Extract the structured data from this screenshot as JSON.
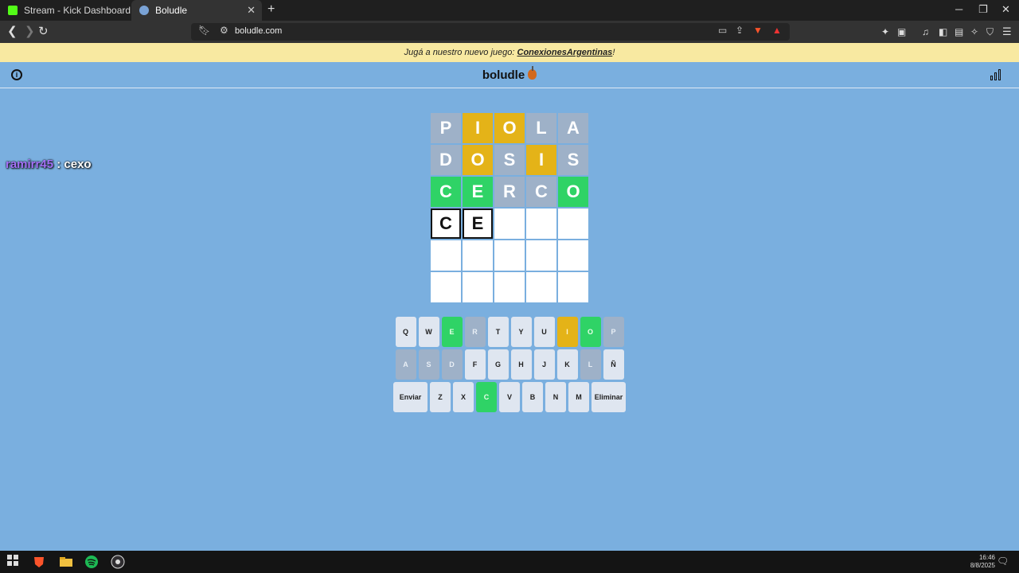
{
  "browser": {
    "tabs": [
      {
        "title": "Stream - Kick Dashboard",
        "active": false
      },
      {
        "title": "Boludle",
        "active": true
      }
    ],
    "new_tab": "+",
    "url": "boludle.com"
  },
  "announcement": {
    "prefix": "Jugá a nuestro nuevo juego: ",
    "link": "ConexionesArgentinas",
    "suffix": "!"
  },
  "header": {
    "title": "boludle"
  },
  "chat": {
    "user": "ramirr45",
    "separator": " : ",
    "message": "cexo"
  },
  "board": [
    [
      {
        "l": "P",
        "s": "gray"
      },
      {
        "l": "I",
        "s": "yellow"
      },
      {
        "l": "O",
        "s": "yellow"
      },
      {
        "l": "L",
        "s": "gray"
      },
      {
        "l": "A",
        "s": "gray"
      }
    ],
    [
      {
        "l": "D",
        "s": "gray"
      },
      {
        "l": "O",
        "s": "yellow"
      },
      {
        "l": "S",
        "s": "gray"
      },
      {
        "l": "I",
        "s": "yellow"
      },
      {
        "l": "S",
        "s": "gray"
      }
    ],
    [
      {
        "l": "C",
        "s": "green"
      },
      {
        "l": "E",
        "s": "green"
      },
      {
        "l": "R",
        "s": "gray"
      },
      {
        "l": "C",
        "s": "gray"
      },
      {
        "l": "O",
        "s": "green"
      }
    ],
    [
      {
        "l": "C",
        "s": "typed"
      },
      {
        "l": "E",
        "s": "typed"
      },
      {
        "l": "",
        "s": "empty"
      },
      {
        "l": "",
        "s": "empty"
      },
      {
        "l": "",
        "s": "empty"
      }
    ],
    [
      {
        "l": "",
        "s": "empty"
      },
      {
        "l": "",
        "s": "empty"
      },
      {
        "l": "",
        "s": "empty"
      },
      {
        "l": "",
        "s": "empty"
      },
      {
        "l": "",
        "s": "empty"
      }
    ],
    [
      {
        "l": "",
        "s": "empty"
      },
      {
        "l": "",
        "s": "empty"
      },
      {
        "l": "",
        "s": "empty"
      },
      {
        "l": "",
        "s": "empty"
      },
      {
        "l": "",
        "s": "empty"
      }
    ]
  ],
  "keyboard": [
    [
      {
        "k": "Q",
        "s": ""
      },
      {
        "k": "W",
        "s": ""
      },
      {
        "k": "E",
        "s": "green"
      },
      {
        "k": "R",
        "s": "gray"
      },
      {
        "k": "T",
        "s": ""
      },
      {
        "k": "Y",
        "s": ""
      },
      {
        "k": "U",
        "s": ""
      },
      {
        "k": "I",
        "s": "yellow"
      },
      {
        "k": "O",
        "s": "green"
      },
      {
        "k": "P",
        "s": "gray"
      }
    ],
    [
      {
        "k": "A",
        "s": "gray"
      },
      {
        "k": "S",
        "s": "gray"
      },
      {
        "k": "D",
        "s": "gray"
      },
      {
        "k": "F",
        "s": ""
      },
      {
        "k": "G",
        "s": ""
      },
      {
        "k": "H",
        "s": ""
      },
      {
        "k": "J",
        "s": ""
      },
      {
        "k": "K",
        "s": ""
      },
      {
        "k": "L",
        "s": "gray"
      },
      {
        "k": "Ñ",
        "s": ""
      }
    ],
    [
      {
        "k": "Enviar",
        "s": "",
        "wide": true
      },
      {
        "k": "Z",
        "s": ""
      },
      {
        "k": "X",
        "s": ""
      },
      {
        "k": "C",
        "s": "green"
      },
      {
        "k": "V",
        "s": ""
      },
      {
        "k": "B",
        "s": ""
      },
      {
        "k": "N",
        "s": ""
      },
      {
        "k": "M",
        "s": ""
      },
      {
        "k": "Eliminar",
        "s": "",
        "wide": true
      }
    ]
  ],
  "taskbar": {
    "time": "16:46",
    "date": "8/8/2025"
  },
  "colors": {
    "background": "#7aafdf",
    "gray": "#9eb1c8",
    "yellow": "#e4b318",
    "green": "#2fd366",
    "announcement": "#f8e9a1"
  }
}
